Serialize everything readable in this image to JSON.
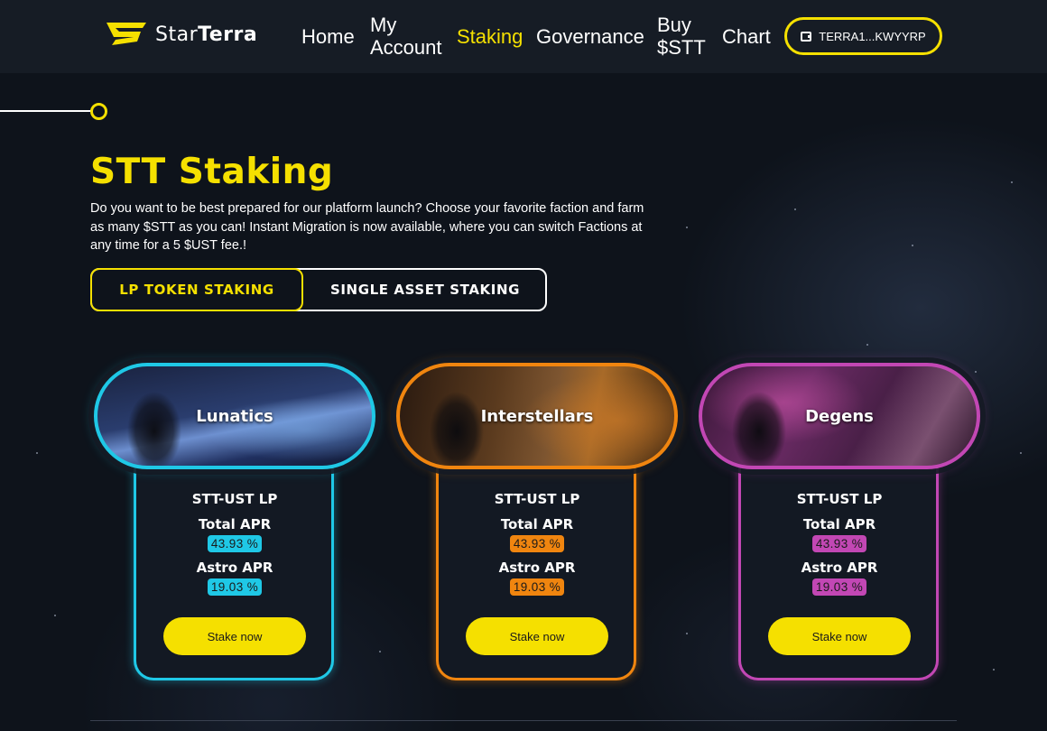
{
  "header": {
    "logo_text_light": "Star",
    "logo_text_bold": "Terra",
    "nav": [
      {
        "line1": "Home",
        "line2": ""
      },
      {
        "line1": "My",
        "line2": "Account"
      },
      {
        "line1": "Staking",
        "line2": ""
      },
      {
        "line1": "Governance",
        "line2": ""
      },
      {
        "line1": "Buy",
        "line2": "$STT"
      },
      {
        "line1": "Chart",
        "line2": ""
      }
    ],
    "active_nav": "Staking",
    "wallet_label": "TERRA1...KWYYRP",
    "wallet_icon": "wallet-icon"
  },
  "page": {
    "title": "STT Staking",
    "intro": "Do you want to be best prepared for our platform launch? Choose your favorite faction and farm as many $STT as you can! Instant Migration is now available, where you can switch Factions at any time for a 5 $UST fee.!"
  },
  "toggle": {
    "lp_label": "LP TOKEN STAKING",
    "single_label": "SINGLE ASSET STAKING",
    "selected": "LP TOKEN STAKING"
  },
  "cards": [
    {
      "faction": "Lunatics",
      "pool": "STT-UST LP",
      "total_apr_label": "Total APR",
      "total_apr": "43.93 %",
      "astro_apr_label": "Astro APR",
      "astro_apr": "19.03 %",
      "button": "Stake now",
      "color": "#1fc8e6"
    },
    {
      "faction": "Interstellars",
      "pool": "STT-UST LP",
      "total_apr_label": "Total APR",
      "total_apr": "43.93 %",
      "astro_apr_label": "Astro APR",
      "astro_apr": "19.03 %",
      "button": "Stake now",
      "color": "#f0850f"
    },
    {
      "faction": "Degens",
      "pool": "STT-UST LP",
      "total_apr_label": "Total APR",
      "total_apr": "43.93 %",
      "astro_apr_label": "Astro APR",
      "astro_apr": "19.03 %",
      "button": "Stake now",
      "color": "#c247b4"
    }
  ],
  "colors": {
    "accent": "#f5e000",
    "background": "#0e131b",
    "header": "#161c25"
  }
}
